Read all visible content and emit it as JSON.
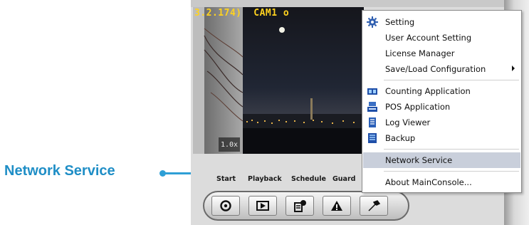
{
  "callout": {
    "label": "Network Service"
  },
  "video": {
    "title": "3.2.174)  CAM1 o",
    "zoom": "1.0x"
  },
  "nav": {
    "labels": [
      "Start",
      "Playback",
      "Schedule",
      "Guard"
    ],
    "buttons": [
      {
        "name": "start-icon"
      },
      {
        "name": "playback-icon"
      },
      {
        "name": "schedule-icon"
      },
      {
        "name": "guard-icon"
      },
      {
        "name": "config-icon"
      }
    ]
  },
  "menu": {
    "items": [
      {
        "label": "Setting",
        "icon": "gear-icon"
      },
      {
        "label": "User Account Setting",
        "icon": ""
      },
      {
        "label": "License Manager",
        "icon": ""
      },
      {
        "label": "Save/Load Configuration",
        "icon": "",
        "submenu": true
      },
      {
        "label": "Counting Application",
        "icon": "counting-icon"
      },
      {
        "label": "POS Application",
        "icon": "pos-icon"
      },
      {
        "label": "Log Viewer",
        "icon": "log-icon"
      },
      {
        "label": "Backup",
        "icon": "backup-icon"
      },
      {
        "label": "Network Service",
        "icon": "",
        "selected": true
      },
      {
        "label": "About MainConsole...",
        "icon": ""
      }
    ]
  },
  "colors": {
    "callout": "#1f8ec6",
    "selection": "#c9cfdb",
    "overlay_text": "#ffd21f"
  }
}
